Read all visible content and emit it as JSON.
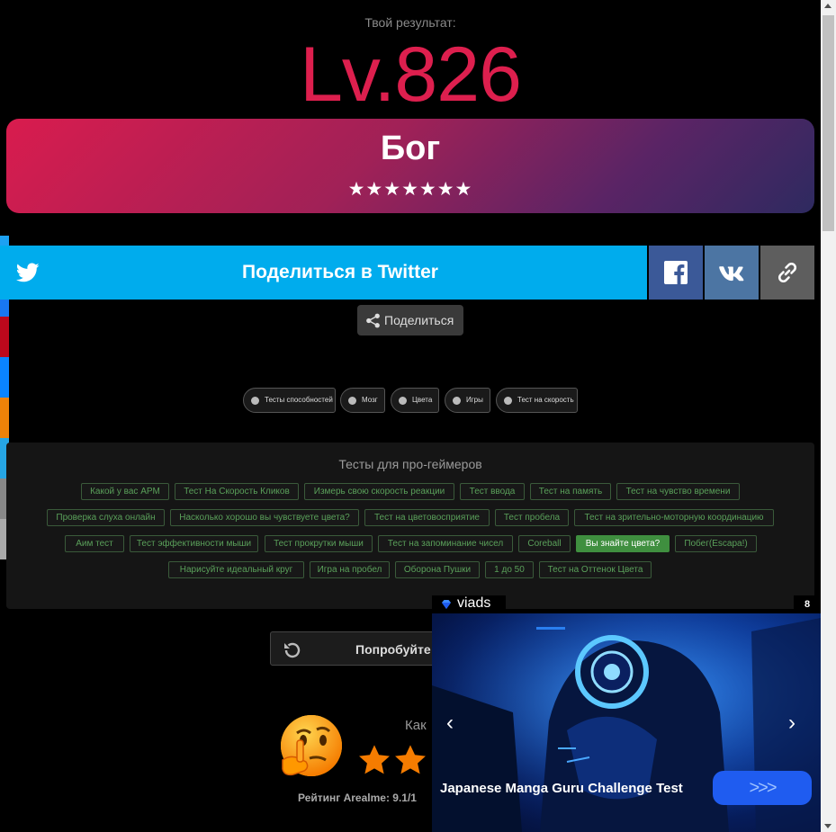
{
  "result": {
    "label": "Твой результат:",
    "level": "Lv.826",
    "rank_title": "Бог",
    "stars": "★★★★★★★"
  },
  "share": {
    "twitter_label": "Поделиться в Twitter",
    "share_label": "Поделиться",
    "colors": {
      "twitter": "#00aced",
      "facebook": "#3b5998",
      "vk": "#4c75a3",
      "link": "#5e5e5e"
    }
  },
  "categories": [
    "Тесты способностей",
    "Мозг",
    "Цвета",
    "Игры",
    "Тест на скорость"
  ],
  "pro_tests": {
    "title": "Тесты для про-геймеров",
    "rows": [
      [
        "Какой у вас APM",
        "Тест На Скорость Кликов",
        "Измерь свою скорость реакции",
        "Тест ввода",
        "Тест на память",
        "Тест на чувство времени"
      ],
      [
        "Проверка слуха онлайн",
        "Насколько хорошо вы чувствуете цвета?",
        "Тест на цветовосприятие",
        "Тест пробела",
        "Тест на зрительно-моторную координацию"
      ],
      [
        "Аим тест",
        "Тест эффективности мыши",
        "Тест прокрутки мыши",
        "Тест на запоминание чисел",
        "Coreball",
        "Вы знайте цвета?",
        "Побег(Escapa!)"
      ],
      [
        "Нарисуйте идеальный круг",
        "Игра на пробел",
        "Оборона Пушки",
        "1 до 50",
        "Тест на Оттенок Цвета"
      ]
    ],
    "active": "Вы знайте цвета?"
  },
  "retry": {
    "label": "Попробуйте с"
  },
  "rating": {
    "question": "Как",
    "footer": "Рейтинг Arealme: 9.1/1",
    "star_color": "#f57c00"
  },
  "ad": {
    "brand": "viads",
    "count": "8",
    "caption": "Japanese Manga Guru Challenge Test",
    "cta": ">>>",
    "prev": "‹",
    "next": "›"
  }
}
